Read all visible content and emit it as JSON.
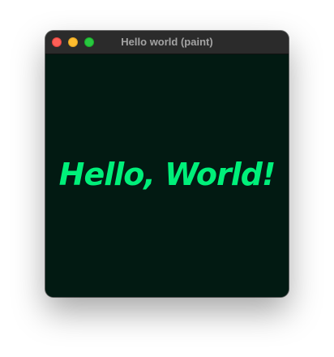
{
  "window": {
    "title": "Hello world (paint)"
  },
  "canvas": {
    "text": "Hello, World!",
    "text_color": "#00f07a",
    "background_color": "#021a12"
  },
  "titlebar_buttons": {
    "close_color": "#fe5f57",
    "minimize_color": "#febc2e",
    "zoom_color": "#28c840"
  }
}
